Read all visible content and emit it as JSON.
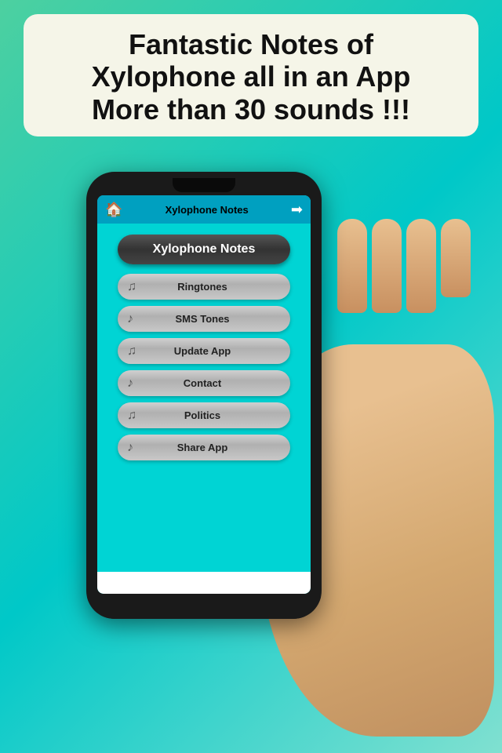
{
  "banner": {
    "line1": "Fantastic Notes of",
    "line2": "Xylophone all in an App",
    "line3": "More than 30 sounds !!!"
  },
  "app": {
    "header": {
      "title": "Xylophone Notes",
      "home_icon": "🏠",
      "exit_icon": "➡"
    },
    "main_button": "Xylophone Notes",
    "menu_items": [
      {
        "label": "Ringtones",
        "icon": "♫"
      },
      {
        "label": "SMS Tones",
        "icon": "♪"
      },
      {
        "label": "Update App",
        "icon": "♫"
      },
      {
        "label": "Contact",
        "icon": "♪"
      },
      {
        "label": "Politics",
        "icon": "♫"
      },
      {
        "label": "Share App",
        "icon": "♪"
      }
    ]
  }
}
